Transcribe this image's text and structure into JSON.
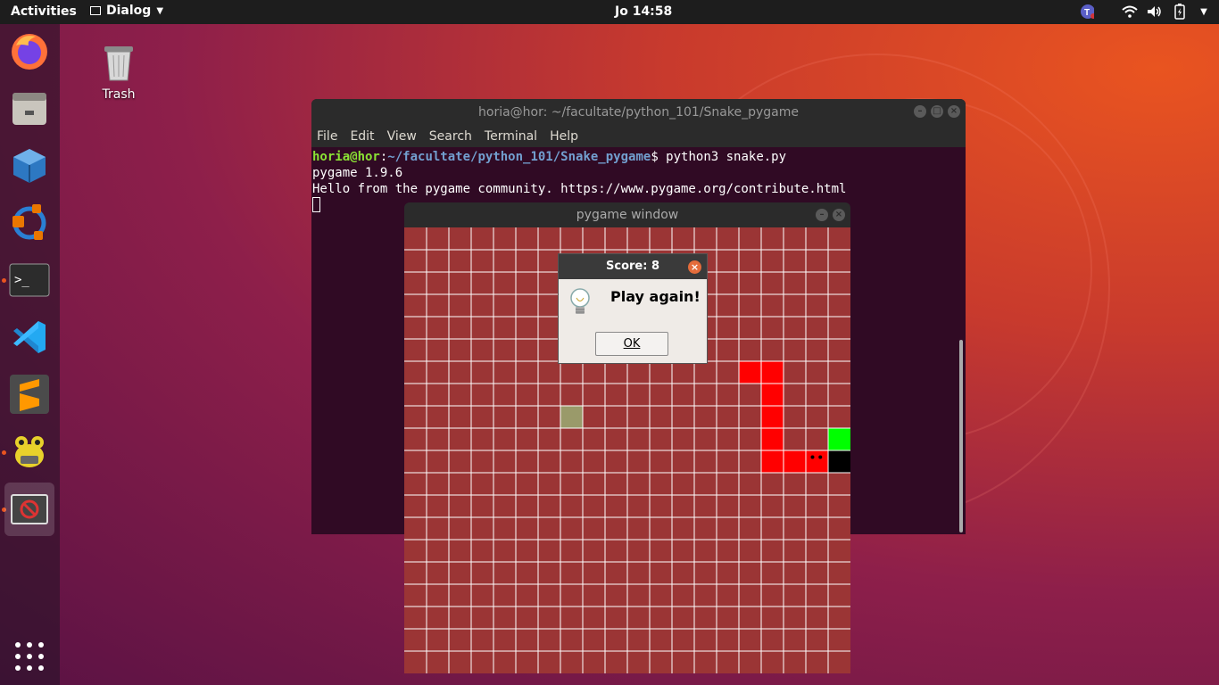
{
  "topbar": {
    "activities": "Activities",
    "app_menu": "Dialog",
    "clock": "Jo 14:58"
  },
  "dock": [
    {
      "name": "firefox-icon",
      "color": "#ff7139"
    },
    {
      "name": "files-icon",
      "color": "#c9c5bd"
    },
    {
      "name": "virtualbox-icon",
      "color": "#2d78c2"
    },
    {
      "name": "blender-like-icon",
      "color": "#ea7600"
    },
    {
      "name": "terminal-icon",
      "color": "#2c2c2c"
    },
    {
      "name": "vscode-icon",
      "color": "#23a9f2"
    },
    {
      "name": "sublime-text-icon",
      "color": "#ff9800"
    },
    {
      "name": "pysolfc-frog-icon",
      "color": "#e8d12b"
    },
    {
      "name": "dialog-app-icon",
      "color": "#d33"
    }
  ],
  "desktop": {
    "trash_label": "Trash"
  },
  "terminal": {
    "title": "horia@hor: ~/facultate/python_101/Snake_pygame",
    "menu": [
      "File",
      "Edit",
      "View",
      "Search",
      "Terminal",
      "Help"
    ],
    "prompt_user": "horia@hor",
    "prompt_sep": ":",
    "prompt_path": "~/facultate/python_101/Snake_pygame",
    "prompt_end": "$ ",
    "command": "python3 snake.py",
    "output": [
      "pygame 1.9.6",
      "Hello from the pygame community. https://www.pygame.org/contribute.html"
    ]
  },
  "pygame": {
    "title": "pygame window",
    "grid_cols": 20,
    "grid_rows": 20,
    "bg_color": "#9b3535",
    "snake_color": "#ff0000",
    "snake_cells": [
      [
        15,
        6
      ],
      [
        16,
        6
      ],
      [
        16,
        7
      ],
      [
        16,
        8
      ],
      [
        16,
        9
      ],
      [
        16,
        10
      ],
      [
        17,
        10
      ],
      [
        18,
        10
      ]
    ],
    "head_cell": [
      18,
      10
    ],
    "food_cell": [
      19,
      9
    ],
    "food_color": "#00ff00",
    "black_cell": [
      19,
      10
    ],
    "olive_cell": [
      7,
      8
    ],
    "olive_color": "#9a9a6a"
  },
  "dialog": {
    "title": "Score: 8",
    "message": "Play again!",
    "ok_label": "OK"
  }
}
